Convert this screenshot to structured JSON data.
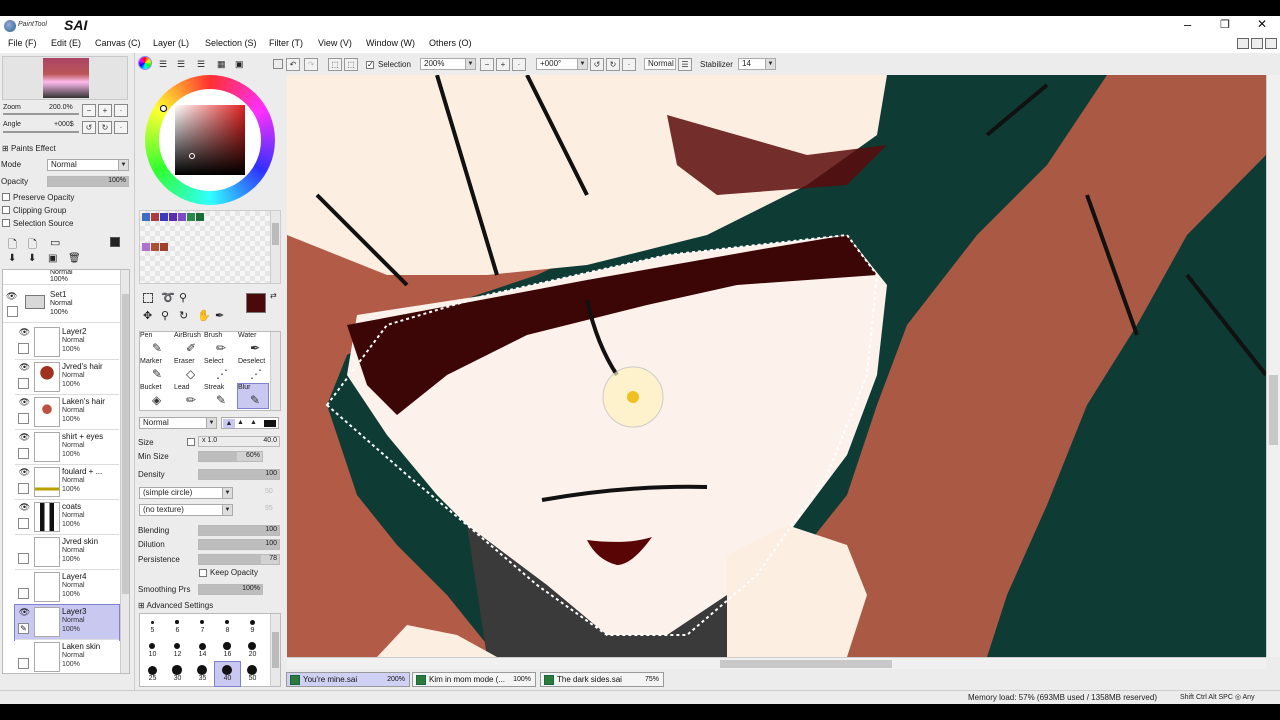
{
  "app": {
    "logo_small": "PaintTool",
    "logo_big": "SAI"
  },
  "menu": [
    {
      "label": "File (F)"
    },
    {
      "label": "Edit (E)"
    },
    {
      "label": "Canvas (C)"
    },
    {
      "label": "Layer (L)"
    },
    {
      "label": "Selection (S)"
    },
    {
      "label": "Filter (T)"
    },
    {
      "label": "View (V)"
    },
    {
      "label": "Window (W)"
    },
    {
      "label": "Others (O)"
    }
  ],
  "window_controls": {
    "minimize": "–",
    "maximize": "❐",
    "close": "✕"
  },
  "navigator": {
    "zoom_label": "Zoom",
    "zoom_value": "200.0%",
    "angle_label": "Angle",
    "angle_value": "+000$"
  },
  "layer_props": {
    "paints_effect": "Paints Effect",
    "mode_label": "Mode",
    "mode_value": "Normal",
    "opacity_label": "Opacity",
    "opacity_value": "100%",
    "opacity_level": 1.0,
    "preserve_opacity": "Preserve Opacity",
    "clipping_group": "Clipping Group",
    "selection_source": "Selection Source"
  },
  "layers": [
    {
      "name": "",
      "mode": "Normal",
      "opacity": "100%",
      "kind": "partial"
    },
    {
      "name": "Set1",
      "mode": "Normal",
      "opacity": "100%",
      "kind": "folder"
    },
    {
      "name": "Layer2",
      "mode": "Normal",
      "opacity": "100%"
    },
    {
      "name": "Jvred's hair",
      "mode": "Normal",
      "opacity": "100%"
    },
    {
      "name": "Laken's hair",
      "mode": "Normal",
      "opacity": "100%"
    },
    {
      "name": "shirt + eyes",
      "mode": "Normal",
      "opacity": "100%"
    },
    {
      "name": "foulard + ...",
      "mode": "Normal",
      "opacity": "100%"
    },
    {
      "name": "coats",
      "mode": "Normal",
      "opacity": "100%"
    },
    {
      "name": "Jvred skin",
      "mode": "Normal",
      "opacity": "100%"
    },
    {
      "name": "Layer4",
      "mode": "Normal",
      "opacity": "100%"
    },
    {
      "name": "Layer3",
      "mode": "Normal",
      "opacity": "100%",
      "active": true
    },
    {
      "name": "Laken skin",
      "mode": "Normal",
      "opacity": "100%"
    }
  ],
  "colors": {
    "primary": "#4a0a0a",
    "swatches": [
      "#3b6fbf",
      "#b03a3a",
      "#3a3ac0",
      "#5a2ab0",
      "#7a4ac8",
      "#2a8a4a",
      "#1a6a3a",
      "#b070d0",
      "#b05030",
      "#a04030"
    ]
  },
  "tools": [
    {
      "label": "Pen",
      "glyph": "✎"
    },
    {
      "label": "AirBrush",
      "glyph": "✐"
    },
    {
      "label": "Brush",
      "glyph": "✏"
    },
    {
      "label": "Water",
      "glyph": "✒"
    },
    {
      "label": "Marker",
      "glyph": "✎"
    },
    {
      "label": "Eraser",
      "glyph": "◇"
    },
    {
      "label": "Select",
      "glyph": "⋰"
    },
    {
      "label": "Deselect",
      "glyph": "⋰"
    },
    {
      "label": "Bucket",
      "glyph": "◈"
    },
    {
      "label": "Lead",
      "glyph": "✏"
    },
    {
      "label": "Streak",
      "glyph": "✎"
    },
    {
      "label": "Blur",
      "glyph": "✎",
      "active": true
    }
  ],
  "brush": {
    "mode": "Normal",
    "size_label": "Size",
    "size_mult": "x 1.0",
    "size_value": "40.0",
    "minsize_label": "Min Size",
    "minsize_value": "60%",
    "minsize_level": 0.6,
    "density_label": "Density",
    "density_value": "100",
    "density_level": 1.0,
    "shape": "(simple circle)",
    "shape_num": "50",
    "texture": "(no texture)",
    "texture_num": "95",
    "blending_label": "Blending",
    "blending_value": "100",
    "blending_level": 1.0,
    "dilution_label": "Dilution",
    "dilution_value": "100",
    "dilution_level": 1.0,
    "persistence_label": "Persistence",
    "persistence_value": "78",
    "persistence_level": 0.78,
    "keep_opacity": "Keep Opacity",
    "smoothing_label": "Smoothing Prs",
    "smoothing_value": "100%",
    "smoothing_level": 1.0,
    "advanced": "Advanced Settings"
  },
  "brush_sizes": [
    "5",
    "6",
    "7",
    "8",
    "9",
    "10",
    "12",
    "14",
    "16",
    "20",
    "25",
    "30",
    "35",
    "40",
    "50"
  ],
  "toolbar": {
    "selection_label": "Selection",
    "zoom": "200%",
    "angle": "+000°",
    "blend_mode": "Normal",
    "stabilizer_label": "Stabilizer",
    "stabilizer_value": "14"
  },
  "doc_tabs": [
    {
      "name": "You're mine.sai",
      "zoom": "200%",
      "active": true
    },
    {
      "name": "Kim in mom mode (...",
      "zoom": "100%"
    },
    {
      "name": "The dark sides.sai",
      "zoom": "75%"
    }
  ],
  "status": {
    "memory": "Memory load: 57% (693MB used / 1358MB reserved)",
    "keys": "Shift Ctrl Alt SPC ◎ Any"
  }
}
